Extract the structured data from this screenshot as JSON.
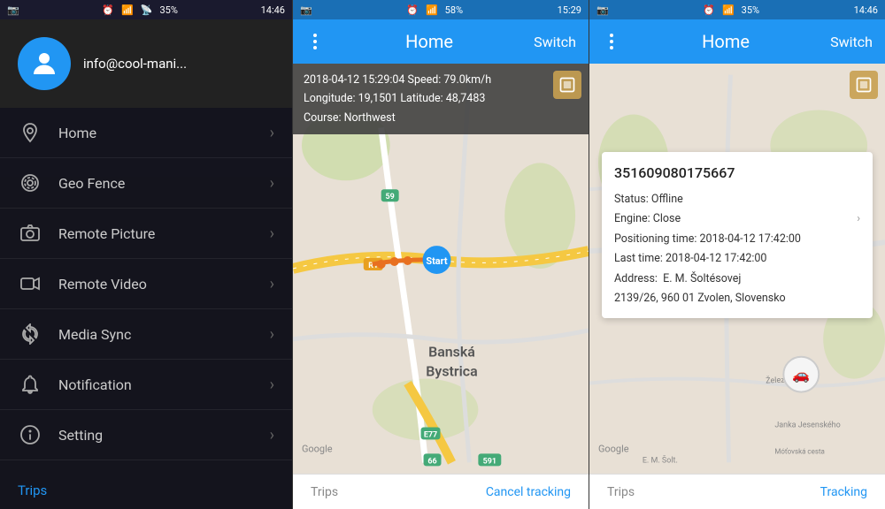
{
  "panel1": {
    "statusbar": {
      "left_icon": "☰",
      "battery": "35%",
      "time": "14:46"
    },
    "profile": {
      "email": "info@cool-mani..."
    },
    "menu_items": [
      {
        "id": "home",
        "label": "Home",
        "icon": "location-pin"
      },
      {
        "id": "geo-fence",
        "label": "Geo Fence",
        "icon": "gear-circle"
      },
      {
        "id": "remote-picture",
        "label": "Remote Picture",
        "icon": "camera"
      },
      {
        "id": "remote-video",
        "label": "Remote Video",
        "icon": "video-camera"
      },
      {
        "id": "media-sync",
        "label": "Media Sync",
        "icon": "sync-circle"
      },
      {
        "id": "notification",
        "label": "Notification",
        "icon": "bell-circle"
      },
      {
        "id": "setting",
        "label": "Setting",
        "icon": "info-circle"
      }
    ],
    "trips_link": "Trips"
  },
  "panel2": {
    "statusbar": {
      "battery": "58%",
      "time": "15:29"
    },
    "header": {
      "title": "Home",
      "switch_label": "Switch"
    },
    "trip_info": {
      "line1": "2018-04-12 15:29:04  Speed: 79.0km/h",
      "line2": "Longitude: 19,1501  Latitude: 48,7483",
      "line3": "Course: Northwest"
    },
    "bottom": {
      "trips": "Trips",
      "cancel": "Cancel tracking"
    },
    "google_label": "Google"
  },
  "panel3": {
    "statusbar": {
      "battery": "35%",
      "time": "14:46"
    },
    "header": {
      "title": "Home",
      "switch_label": "Switch"
    },
    "device": {
      "id": "351609080175667",
      "status_label": "Status:",
      "status_value": "Offline",
      "engine_label": "Engine:",
      "engine_value": "Close",
      "positioning_label": "Positioning time:",
      "positioning_value": "2018-04-12 17:42:00",
      "last_label": "Last time:",
      "last_value": "2018-04-12 17:42:00",
      "address_label": "Address:",
      "address_value": "E. M. Šoltésovej\n2139/26, 960 01 Zvolen, Slovensko"
    },
    "bottom": {
      "trips": "Trips",
      "tracking": "Tracking"
    },
    "google_label": "Google"
  }
}
